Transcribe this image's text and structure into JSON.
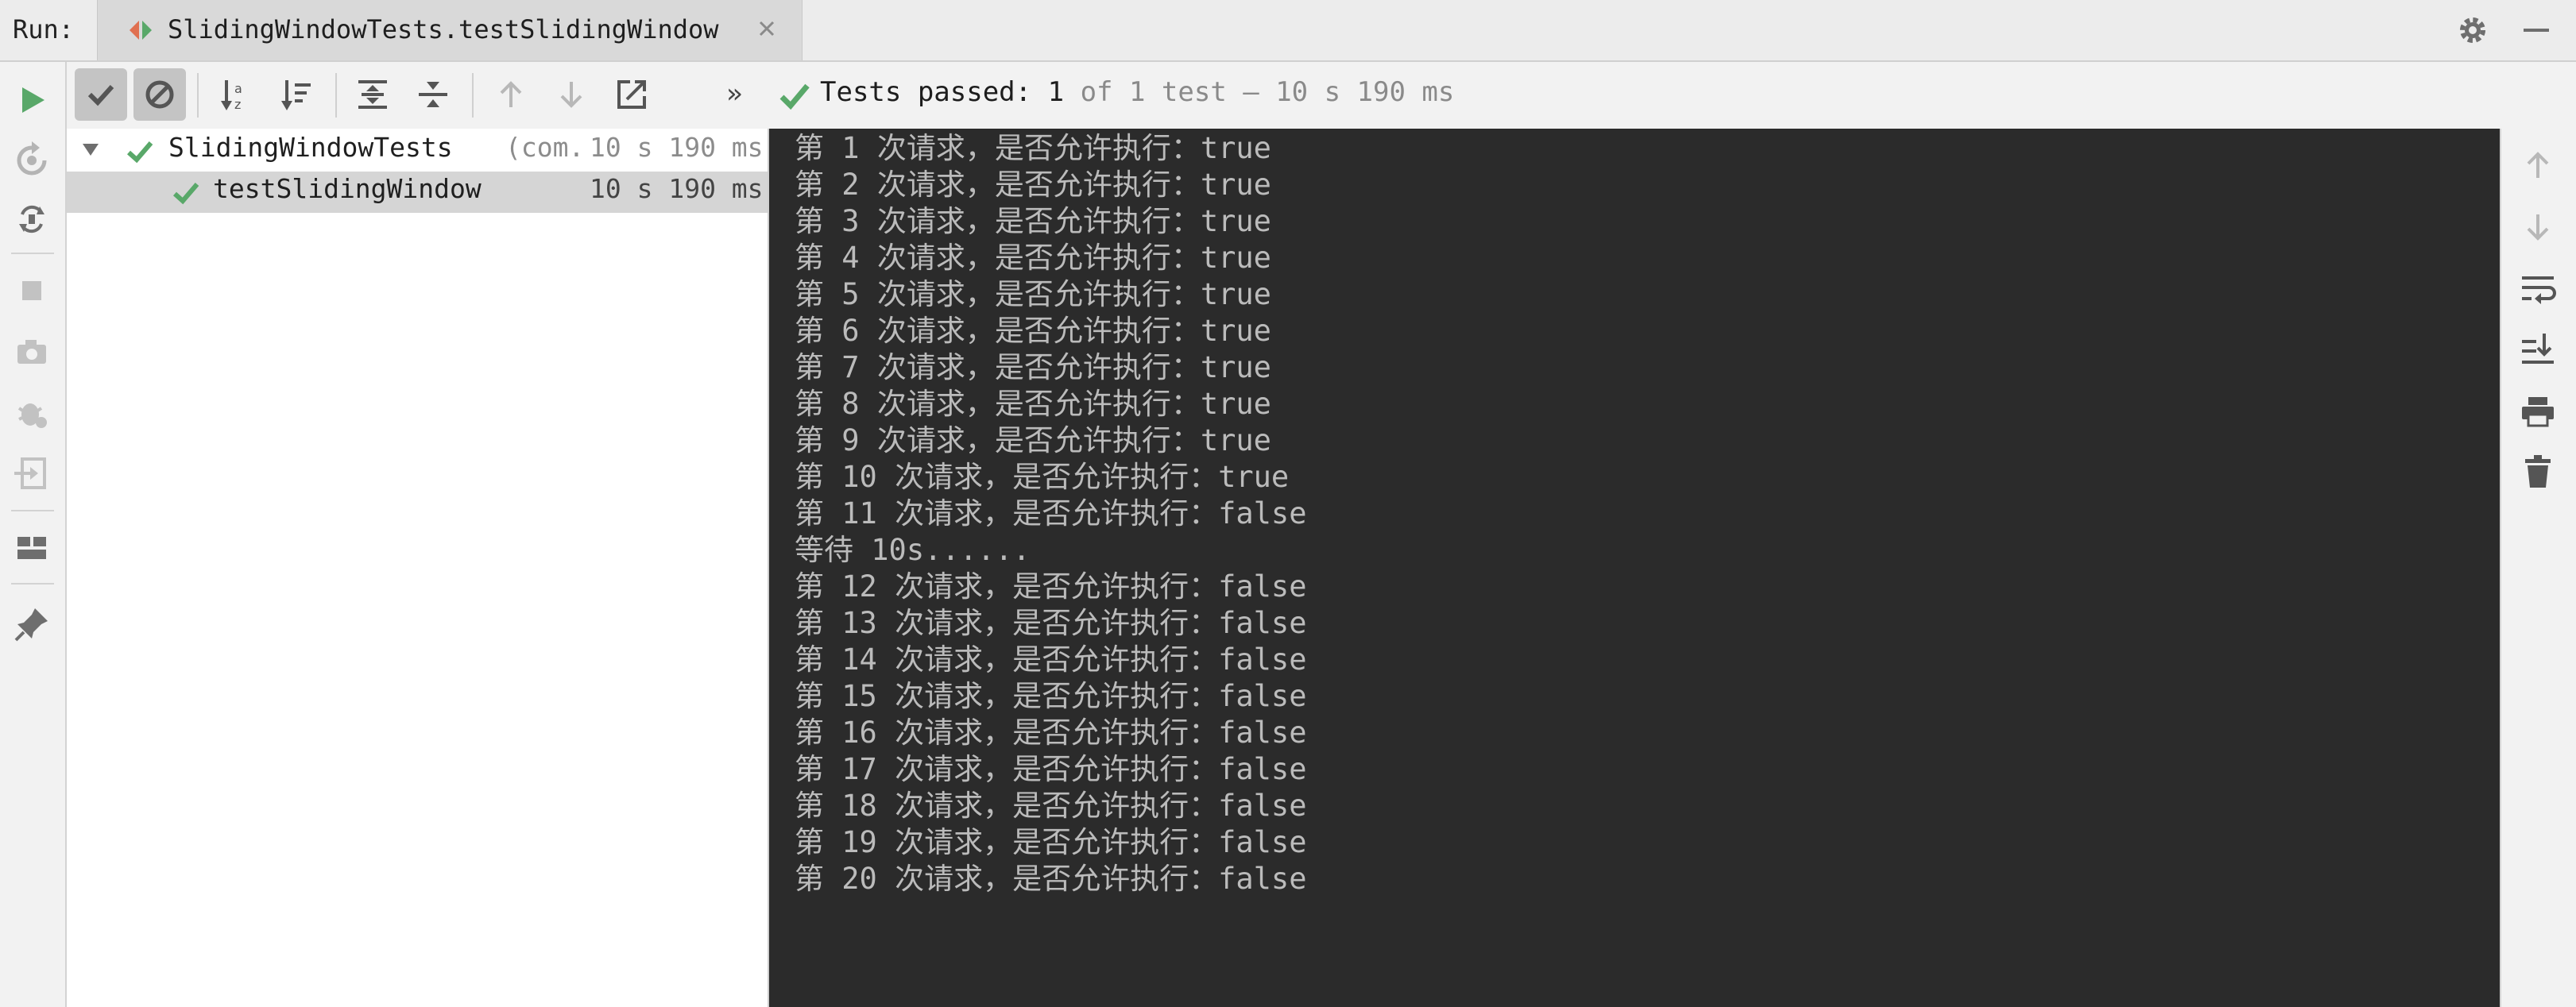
{
  "header": {
    "run_label": "Run:",
    "tab_title": "SlidingWindowTests.testSlidingWindow"
  },
  "toolbar": {
    "status_label": "Tests passed:",
    "status_count": "1",
    "status_detail": "of 1 test – 10 s 190 ms",
    "more_glyph": "»"
  },
  "tree": {
    "rows": [
      {
        "name": "SlidingWindowTests",
        "package": "(com.",
        "time": "10 s 190 ms"
      },
      {
        "name": "testSlidingWindow",
        "time": "10 s 190 ms"
      }
    ]
  },
  "console": {
    "lines": [
      "第 1 次请求，是否允许执行：true",
      "第 2 次请求，是否允许执行：true",
      "第 3 次请求，是否允许执行：true",
      "第 4 次请求，是否允许执行：true",
      "第 5 次请求，是否允许执行：true",
      "第 6 次请求，是否允许执行：true",
      "第 7 次请求，是否允许执行：true",
      "第 8 次请求，是否允许执行：true",
      "第 9 次请求，是否允许执行：true",
      "第 10 次请求，是否允许执行：true",
      "第 11 次请求，是否允许执行：false",
      "等待 10s......",
      "第 12 次请求，是否允许执行：false",
      "第 13 次请求，是否允许执行：false",
      "第 14 次请求，是否允许执行：false",
      "第 15 次请求，是否允许执行：false",
      "第 16 次请求，是否允许执行：false",
      "第 17 次请求，是否允许执行：false",
      "第 18 次请求，是否允许执行：false",
      "第 19 次请求，是否允许执行：false",
      "第 20 次请求，是否允许执行：false"
    ]
  },
  "colors": {
    "accent_green": "#59a869",
    "console_bg": "#2b2b2b",
    "console_text": "#bbbbbb",
    "icon_gray": "#6e6e6e"
  }
}
